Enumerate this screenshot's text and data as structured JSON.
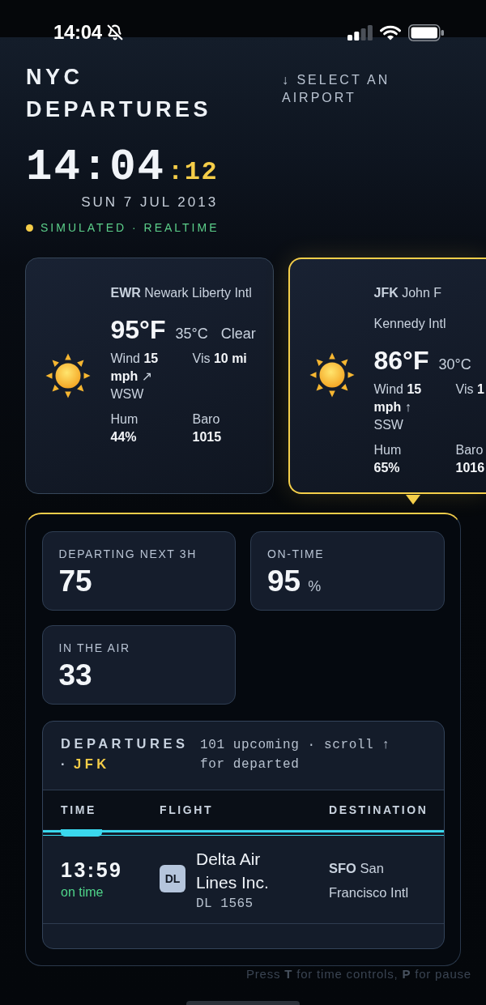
{
  "status_bar": {
    "time": "14:04"
  },
  "header": {
    "title": "NYC DEPARTURES",
    "airport_hint": "↓ SELECT AN AIRPORT",
    "clock": {
      "time": "14:04",
      "seconds": ":12",
      "date": "SUN 7 JUL 2013"
    },
    "mode": "SIMULATED · REALTIME"
  },
  "airports": [
    {
      "heading": "**EWR** Newark Liberty Intl",
      "selected": false,
      "temp_f": "95°F",
      "temp_c": "35°C",
      "condition": "Clear",
      "wind": "Wind **15 mph** ↗ WSW",
      "visibility": "Vis **10 mi**",
      "humidity": {
        "label": "Hum",
        "value": "44%"
      },
      "pressure": {
        "label": "Baro",
        "value": "1015"
      }
    },
    {
      "heading": "**JFK** John F Kennedy Intl",
      "selected": true,
      "temp_f": "86°F",
      "temp_c": "30°C",
      "wind": "Wind **15 mph** ↑ SSW",
      "visibility": "Vis **1**",
      "humidity": {
        "label": "Hum",
        "value": "65%"
      },
      "pressure": {
        "label": "Baro",
        "value": "1016"
      }
    }
  ],
  "stats": [
    {
      "label": "DEPARTING NEXT 3H",
      "value": "75"
    },
    {
      "label": "ON-TIME",
      "value": "95",
      "unit": "%"
    },
    {
      "label": "IN THE AIR",
      "value": "33"
    }
  ],
  "departures": {
    "title": "DEPARTURES",
    "separator": "·",
    "airport": "JFK",
    "summary": "101 upcoming · scroll ↑ for departed",
    "columns": [
      "TIME",
      "FLIGHT",
      "DESTINATION"
    ],
    "rows": [
      {
        "time": "13:59",
        "status": "on time",
        "airline_code": "DL",
        "airline": "Delta Air Lines Inc.",
        "flight": "DL 1565",
        "destination": "**SFO** San Francisco Intl"
      }
    ]
  },
  "footer_hint": "Press **T** for time controls, **P** for pause"
}
